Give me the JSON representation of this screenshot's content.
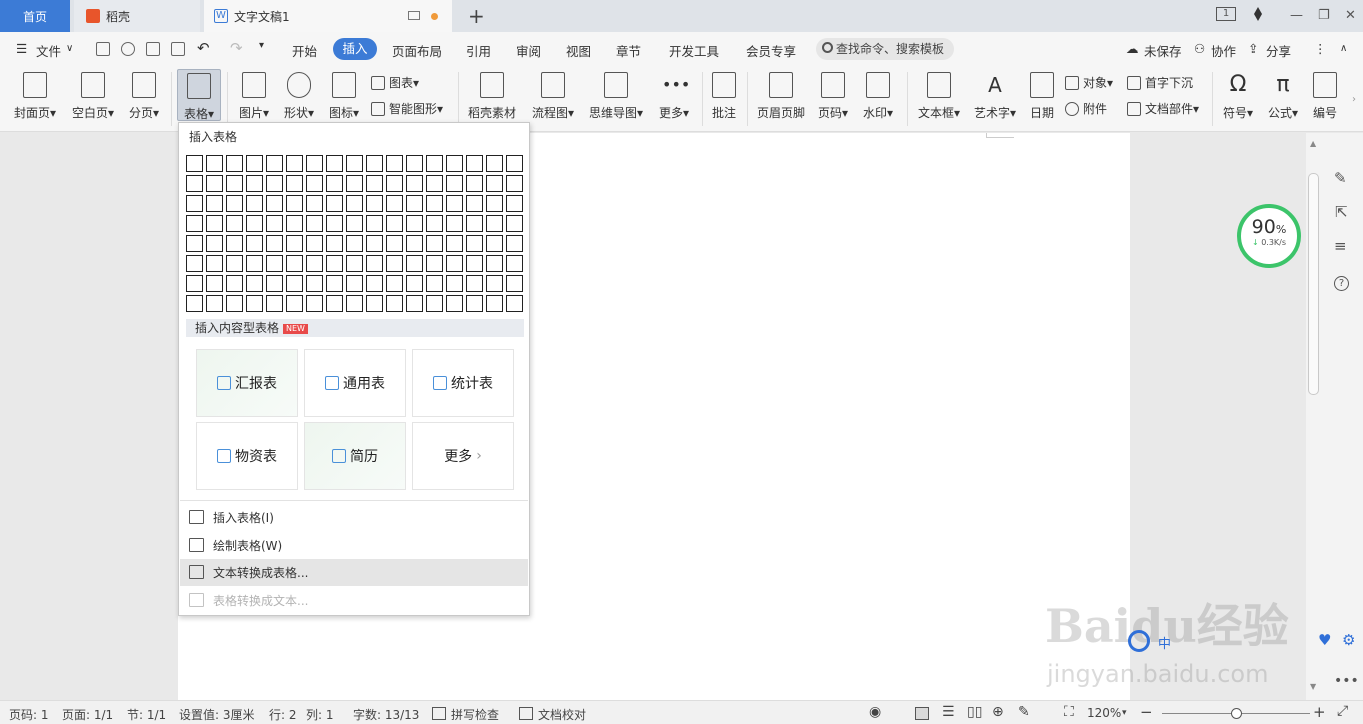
{
  "tabs": {
    "home": "首页",
    "docer": "稻壳",
    "doc": "文字文稿1"
  },
  "window": {
    "badge": "1"
  },
  "menu": {
    "file": "文件",
    "items": [
      "开始",
      "插入",
      "页面布局",
      "引用",
      "审阅",
      "视图",
      "章节",
      "开发工具",
      "会员专享"
    ],
    "search": "查找命令、搜索模板",
    "unsaved": "未保存",
    "collab": "协作",
    "share": "分享"
  },
  "ribbon": {
    "cover": "封面页",
    "blank": "空白页",
    "pagebreak": "分页",
    "table": "表格",
    "picture": "图片",
    "shape": "形状",
    "icon": "图标",
    "chart": "图表",
    "smartart": "智能图形",
    "docer_material": "稻壳素材",
    "flowchart": "流程图",
    "mindmap": "思维导图",
    "more": "更多",
    "comment": "批注",
    "header_footer": "页眉页脚",
    "page_number": "页码",
    "watermark": "水印",
    "textbox": "文本框",
    "wordart": "艺术字",
    "date": "日期",
    "object": "对象",
    "attachment": "附件",
    "dropcap": "首字下沉",
    "docpart": "文档部件",
    "symbol": "符号",
    "formula": "公式",
    "numbering": "编号"
  },
  "dropdown": {
    "title": "插入表格",
    "content_header": "插入内容型表格",
    "new_badge": "NEW",
    "cards": [
      "汇报表",
      "通用表",
      "统计表",
      "物资表",
      "简历",
      "更多"
    ],
    "items": [
      {
        "label": "插入表格(I)"
      },
      {
        "label": "绘制表格(W)"
      },
      {
        "label": "文本转换成表格..."
      },
      {
        "label": "表格转换成文本..."
      }
    ]
  },
  "speed": {
    "percent": "90",
    "unit": "%",
    "rate": "0.3K/s"
  },
  "status": {
    "page_no": "页码: 1",
    "pages": "页面: 1/1",
    "section": "节: 1/1",
    "setting": "设置值: 3厘米",
    "row": "行: 2",
    "col": "列: 1",
    "words": "字数: 13/13",
    "spell": "拼写检查",
    "proof": "文档校对",
    "zoom": "120%",
    "zoom_fraction": 0.5
  },
  "watermark": {
    "main": "Baidu经验",
    "sub": "jingyan.baidu.com"
  },
  "colors": {
    "accent": "#3c7bd6",
    "speed_ring": "#3cc46a",
    "new_badge": "#e84a4a"
  }
}
